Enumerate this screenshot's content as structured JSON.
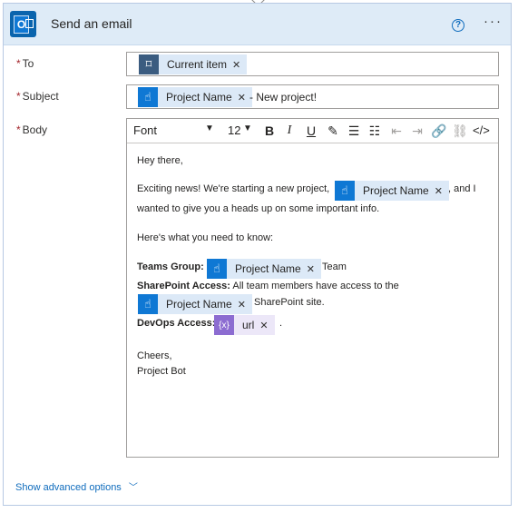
{
  "header": {
    "title": "Send an email",
    "help_glyph": "?",
    "more_glyph": "···"
  },
  "fields": {
    "to": {
      "label": "To",
      "token": "Current item"
    },
    "subject": {
      "label": "Subject",
      "token": "Project Name",
      "suffix": "- New project!"
    },
    "body": {
      "label": "Body"
    }
  },
  "toolbar": {
    "font": "Font",
    "size": "12",
    "buttons": [
      "bold",
      "italic",
      "underline",
      "highlight",
      "bulleted-list",
      "numbered-list",
      "decrease-indent",
      "increase-indent",
      "link",
      "unlink",
      "code-view"
    ]
  },
  "body": {
    "greeting": "Hey there,",
    "line1_start": "Exciting news! We're starting a new project,",
    "line1_token": "Project Name",
    "line1_end": ", and I",
    "line2": "wanted to give you a heads up on some important info.",
    "line3": "Here's what you need to know:",
    "teams_label": "Teams Group:",
    "teams_token": "Project Name",
    "teams_suffix": "Team",
    "sharepoint_label": "SharePoint Access:",
    "sharepoint_text": "All team members have access to the",
    "sharepoint_token": "Project Name",
    "sharepoint_suffix": "SharePoint site.",
    "devops_label": "DevOps Access:",
    "devops_token": "url",
    "devops_suffix": ".",
    "closing": "Cheers,",
    "signature": "Project Bot"
  },
  "footer": {
    "advanced_label": "Show advanced options"
  },
  "colors": {
    "header_bg": "#deebf7",
    "token_bg": "#dce9f7",
    "token_icon": "#0f78d4",
    "expression_icon": "#8c6cd1",
    "link": "#0f6cbd",
    "required": "#a4262c"
  }
}
